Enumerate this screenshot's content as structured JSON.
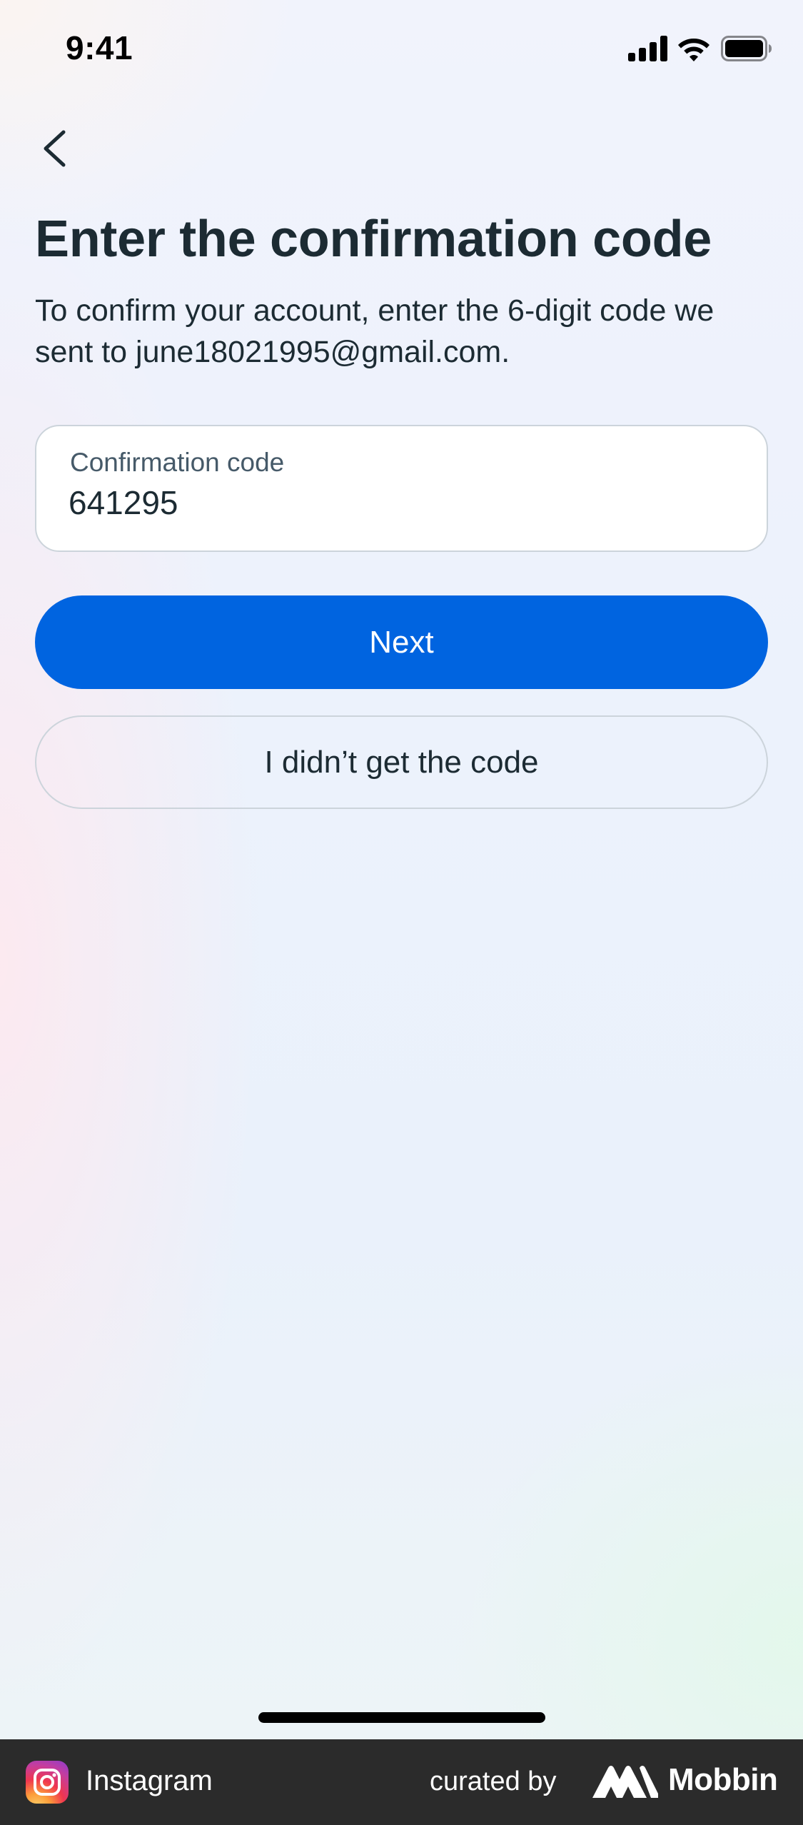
{
  "status_bar": {
    "time": "9:41",
    "icons": [
      "signal-icon",
      "wifi-icon",
      "battery-icon"
    ]
  },
  "nav": {
    "back_icon": "chevron-left-icon"
  },
  "content": {
    "title": "Enter the confirmation code",
    "description": "To confirm your account, enter the 6-digit code we sent to june18021995@gmail.com.",
    "code_field": {
      "label": "Confirmation code",
      "value": "641295"
    },
    "next_label": "Next",
    "no_code_label": "I didn’t get the code"
  },
  "attribution": {
    "app_name": "Instagram",
    "curated_by": "curated by",
    "brand": "Mobbin"
  },
  "colors": {
    "primary": "#0064e0",
    "text": "#1c2b33",
    "border": "#ccd4db"
  }
}
